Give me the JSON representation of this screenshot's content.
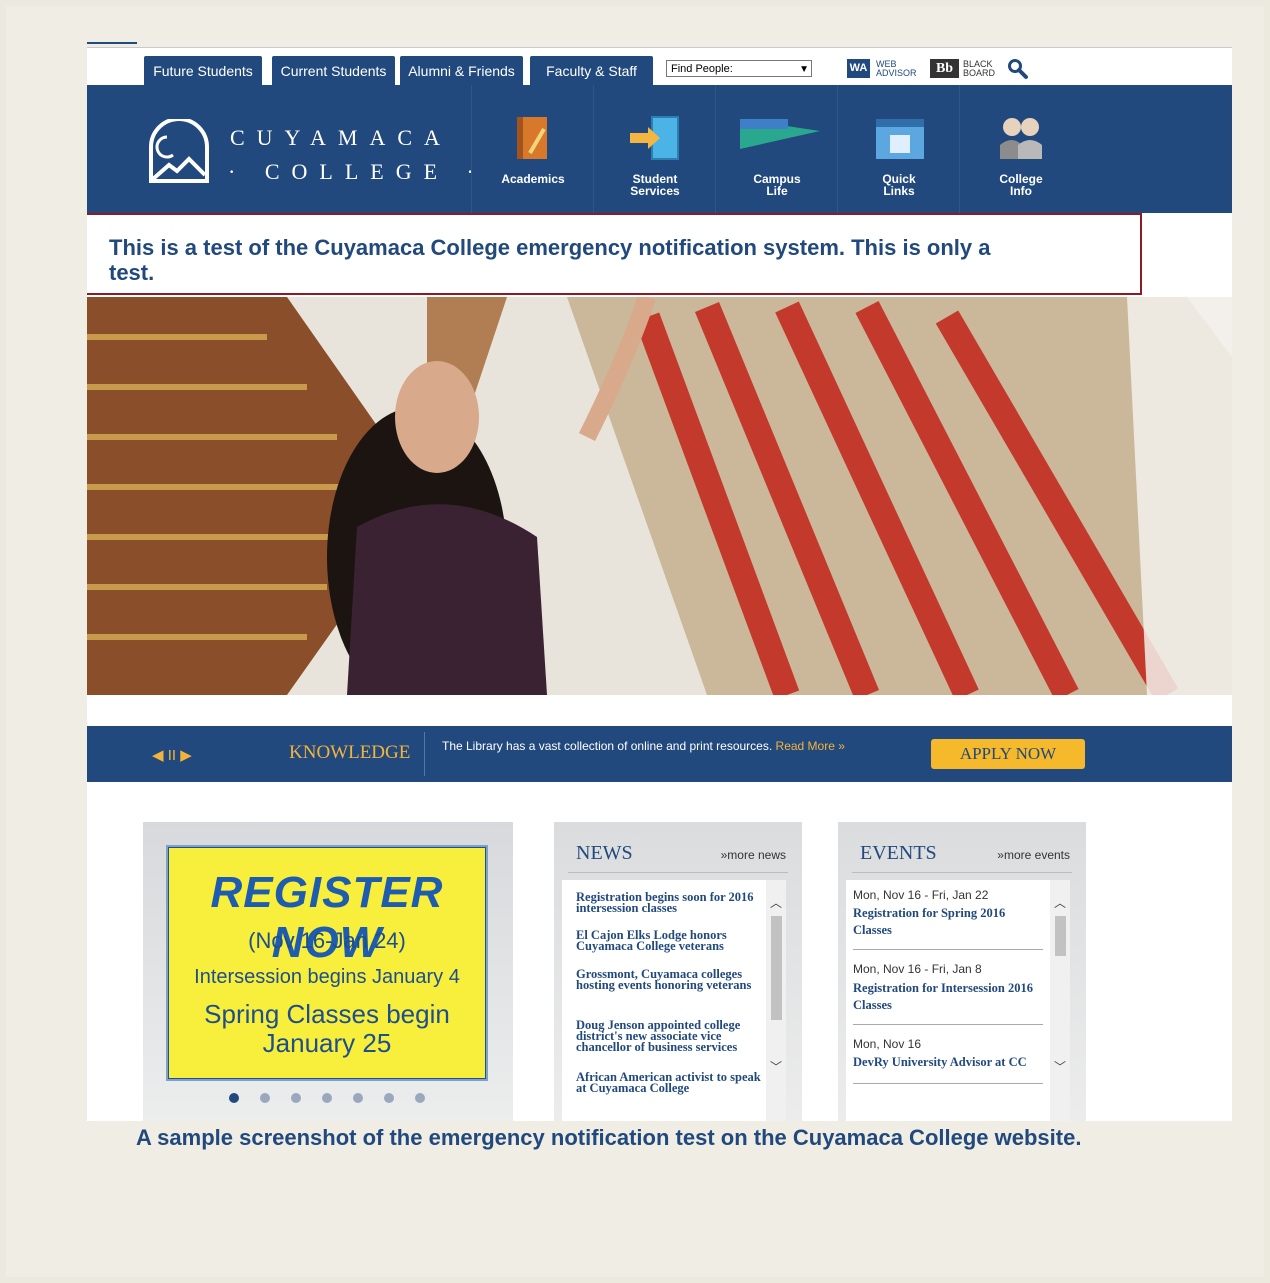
{
  "topbar": {
    "tabs": [
      "Future Students",
      "Current Students",
      "Alumni & Friends",
      "Faculty & Staff"
    ],
    "find_people": "Find People:",
    "webadvisor": {
      "badge": "WA",
      "line1": "WEB",
      "line2": "ADVISOR"
    },
    "blackboard": {
      "badge": "Bb",
      "line1": "BLACK",
      "line2": "BOARD"
    }
  },
  "logo": {
    "line1": "CUYAMACA",
    "line2": "· COLLEGE ·"
  },
  "nav": [
    {
      "label1": "Academics",
      "label2": "",
      "icon": "book-pencil-icon"
    },
    {
      "label1": "Student",
      "label2": "Services",
      "icon": "door-arrow-icon"
    },
    {
      "label1": "Campus",
      "label2": "Life",
      "icon": "pennant-icon"
    },
    {
      "label1": "Quick",
      "label2": "Links",
      "icon": "window-icon"
    },
    {
      "label1": "College",
      "label2": "Info",
      "icon": "people-icon"
    }
  ],
  "alert": {
    "text": "This is a test of the Cuyamaca College emergency notification system. This is only a test."
  },
  "ticker": {
    "controls": "◀ II ▶",
    "heading": "KNOWLEDGE",
    "text": "The Library has a vast collection of online and print resources.",
    "more": "Read More »",
    "apply": "APPLY NOW"
  },
  "promo": {
    "line1": "REGISTER NOW",
    "line2": "(Nov 16-Jan 24)",
    "line3": "Intersession begins January 4",
    "line4": "Spring Classes begin January 25"
  },
  "news": {
    "title": "NEWS",
    "more": "»more news",
    "items": [
      "Registration begins soon for 2016 intersession classes",
      "El Cajon Elks Lodge honors Cuyamaca College veterans",
      "Grossmont, Cuyamaca colleges hosting events honoring veterans",
      "Doug Jenson appointed college district's new associate vice chancellor of business services",
      "African American activist to speak at Cuyamaca College"
    ]
  },
  "events": {
    "title": "EVENTS",
    "more": "»more events",
    "items": [
      {
        "date": "Mon, Nov 16 - Fri, Jan 22",
        "title": "Registration for Spring 2016 Classes"
      },
      {
        "date": "Mon, Nov 16 - Fri, Jan 8",
        "title": "Registration for Intersession 2016 Classes"
      },
      {
        "date": "Mon, Nov 16",
        "title": "DevRy University Advisor at CC"
      }
    ]
  },
  "caption": "A sample screenshot of the emergency notification test on the Cuyamaca College website.",
  "colors": {
    "brand": "#21497d",
    "accent": "#f6b92b",
    "alert_border": "#8e1b24"
  }
}
